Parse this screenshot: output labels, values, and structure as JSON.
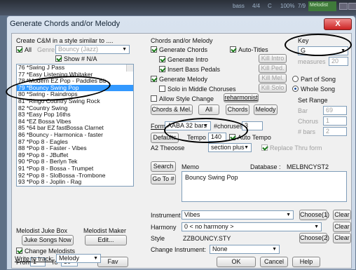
{
  "bg": {
    "t1": "bass",
    "t2": "4/4",
    "t3": "C",
    "t4": "100%",
    "t5": "7/9",
    "green": "Melodist"
  },
  "title": "Generate Chords and/or Melody",
  "close": "X",
  "left": {
    "create_label": "Create C&M in a style similar to ....",
    "all_label": "All",
    "genre_label": "Genre",
    "genre_value": "Bouncy (Jazz)",
    "show_fav": "Show # N/A",
    "songs": [
      "76 *Swing J Pass",
      "77 *Easy Listening Whitaker",
      "78 *Modern EZ Pop - Paddles Bb",
      "79 *Bouncy Swing Pop",
      "80 *Swing - Raindrops",
      "81 *Ringo Country Swing Rock",
      "82 *Country Swing",
      "83 *Easy Pop 16ths",
      "84 *EZ Bossa Vibes",
      "85 *64 bar EZ fastBossa Clarnet",
      "86 *Bouncy - Harmonica - faster",
      "87 *Pop 8 - Eagles",
      "88 *Pop 8 - Faster - Vibes",
      "89 *Pop 8 - JBuffet",
      "90 *Pop 8 - Berlyn Tek",
      "91 *Pop 8 - Bossa - Trumpet",
      "92 *Pop 8 - SloBossa -Trombone",
      "93 *Pop 8 - Joplin - Rag"
    ],
    "selected_index": 3,
    "jukebox_label": "Melodist Juke Box",
    "maker_label": "Melodist Maker",
    "juke_btn": "Juke Songs Now",
    "edit_btn": "Edit...",
    "change_melodists": "Change Melodists",
    "from_label": "From",
    "from_val": "1",
    "to_label": "To",
    "to_val": "50",
    "fav_btn": "Fav",
    "write_label": "Write to track:",
    "track_val": "Melody"
  },
  "mid": {
    "chords_label": "Chords and/or Melody",
    "gen_chords": "Generate Chords",
    "auto_titles": "Auto-Titles",
    "gen_intro": "Generate Intro",
    "kill_intro": "Kill Intro",
    "insert_bass": "Insert Bass Pedals",
    "kill_ped": "Kill Ped.",
    "gen_melody": "Generate Melody",
    "kill_mel": "Kill Mel.",
    "solo": "Solo in Middle Choruses",
    "kill_solo": "Kill Solo",
    "allow_style": "Allow Style Change",
    "reharmonist": "reharmonist",
    "cm_btn": "Chords & Mel.",
    "all_btn": "All",
    "chords_btn": "Chords",
    "melody_btn": "Melody",
    "form_label": "Form",
    "form_val": "AABA 32 bars",
    "choruses_label": "#choruses",
    "choruses_val": "3",
    "defaults_btn": "Defaults",
    "tempo_label": "Tempo",
    "tempo_val": "140",
    "auto_tempo": "Auto Tempo",
    "a2_label": "A2 Theoose",
    "section_val": "section plus",
    "replace_label": "Replace Thru form",
    "search_btn": "Search",
    "memo_label": "Memo",
    "database_label": "Database :",
    "database_val": "MELBNCYST2",
    "goto_btn": "Go To #",
    "memo_text": "Bouncy Swing Pop",
    "instrument_label": "Instrument",
    "instrument_val": "Vibes",
    "choose1": "Choose(1)",
    "clear1": "Clear",
    "harmony_label": "Harmony",
    "harmony_val": "0 < no harmony >",
    "clear2": "Clear",
    "style_label": "Style",
    "style_val": "ZZBOUNCY.STY",
    "choose2": "Choose(2)",
    "clear3": "Clear",
    "change_inst_label": "Change Instrument:",
    "change_inst_val": "None",
    "ok_btn": "OK",
    "cancel_btn": "Cancel",
    "help_btn": "Help"
  },
  "right": {
    "key_label": "Key",
    "key_val": "G",
    "measures_label": "measures",
    "measures_val": "20",
    "part_song": "Part of Song",
    "whole_song": "Whole Song",
    "set_range": "Set Range",
    "bar_label": "Bar",
    "bar_val": "69",
    "chorus_label": "Chorus",
    "chorus_val": "1",
    "bars_label": "# bars",
    "bars_val": "2"
  }
}
